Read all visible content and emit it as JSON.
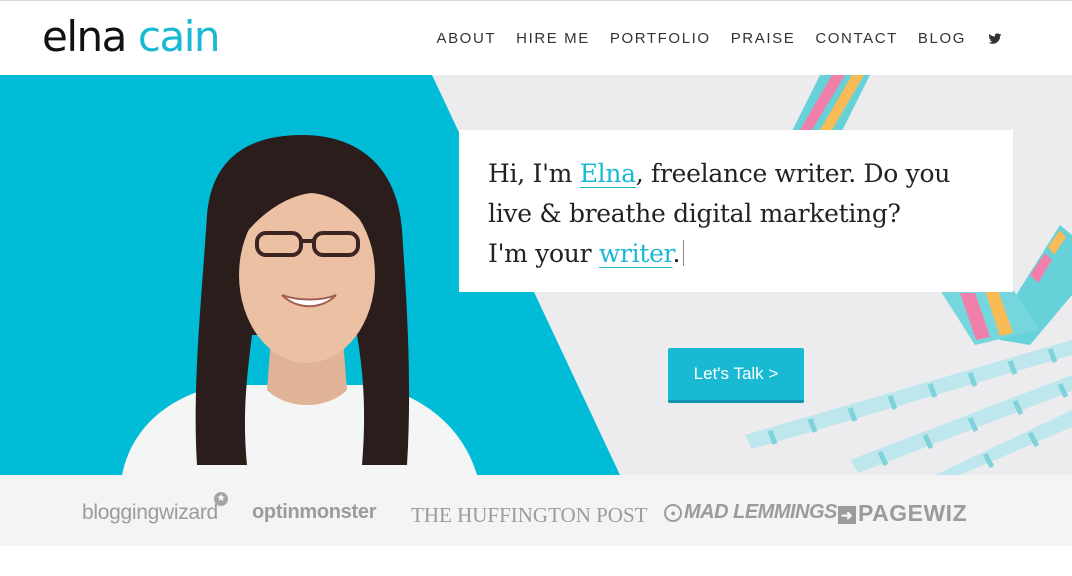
{
  "header": {
    "logo_first": "elna",
    "logo_last": "cain",
    "nav": [
      {
        "label": "ABOUT"
      },
      {
        "label": "HIRE ME"
      },
      {
        "label": "PORTFOLIO"
      },
      {
        "label": "PRAISE"
      },
      {
        "label": "CONTACT"
      },
      {
        "label": "BLOG"
      }
    ],
    "social_icon": "twitter-icon"
  },
  "hero": {
    "line1_a": "Hi, I'm ",
    "line1_link": "Elna",
    "line1_b": ", freelance writer. Do you",
    "line2": "live & breathe digital marketing?",
    "line3_a": "I'm your ",
    "line3_link": "writer",
    "line3_b": ".",
    "cta_label": "Let's Talk >"
  },
  "logos": {
    "blogging_wizard": "bloggingwizard",
    "optinmonster": "optinmonster",
    "huffington": "THE HUFFINGTON POST",
    "mad_lemmings": "MAD LEMMINGS",
    "pagewiz": "PAGEWIZ"
  },
  "colors": {
    "accent": "#19b9d4",
    "text": "#222222",
    "logo_gray": "#9b9b9b"
  }
}
